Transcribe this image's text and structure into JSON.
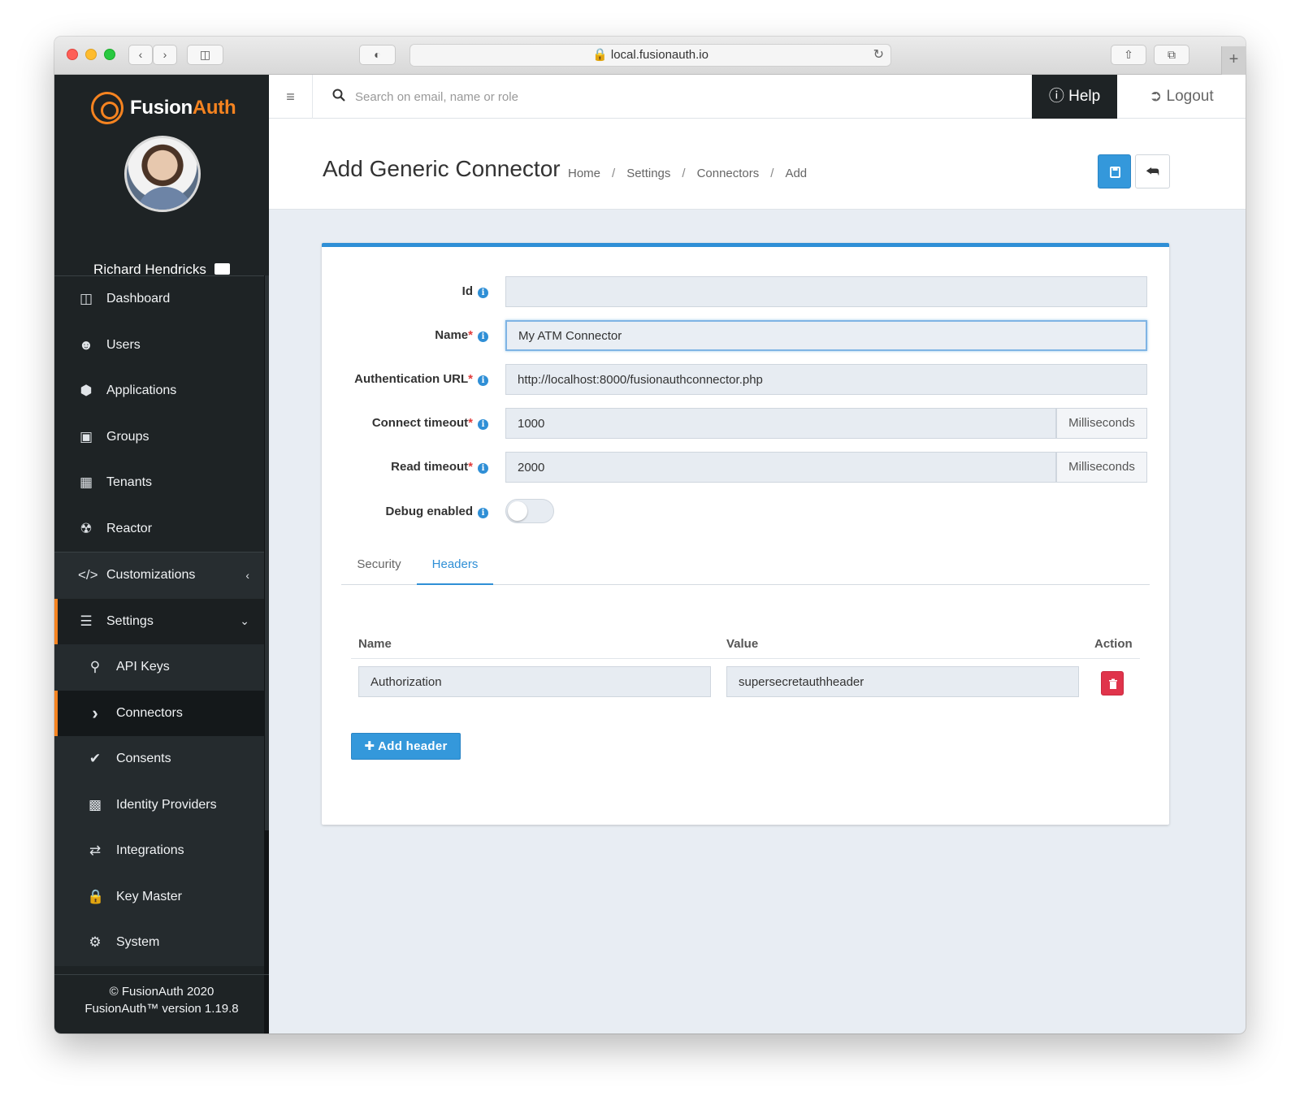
{
  "browser": {
    "url": "local.fusionauth.io"
  },
  "brand": {
    "name_part1": "Fusion",
    "name_part2": "Auth",
    "accent": "#f58320"
  },
  "user": {
    "name": "Richard Hendricks"
  },
  "topbar": {
    "search_placeholder": "Search on email, name or role",
    "help_label": "Help",
    "logout_label": "Logout"
  },
  "sidebar": {
    "items": [
      {
        "label": "Dashboard",
        "icon": "dashboard-icon"
      },
      {
        "label": "Users",
        "icon": "users-icon"
      },
      {
        "label": "Applications",
        "icon": "cube-icon"
      },
      {
        "label": "Groups",
        "icon": "groups-icon"
      },
      {
        "label": "Tenants",
        "icon": "building-icon"
      },
      {
        "label": "Reactor",
        "icon": "reactor-icon"
      }
    ],
    "customizations_label": "Customizations",
    "settings_label": "Settings",
    "settings_children": [
      {
        "label": "API Keys",
        "icon": "key-icon"
      },
      {
        "label": "Connectors",
        "icon": "chevron-right-icon"
      },
      {
        "label": "Consents",
        "icon": "check-icon"
      },
      {
        "label": "Identity Providers",
        "icon": "id-badge-icon"
      },
      {
        "label": "Integrations",
        "icon": "exchange-icon"
      },
      {
        "label": "Key Master",
        "icon": "lock-icon"
      },
      {
        "label": "System",
        "icon": "gear-icon"
      }
    ],
    "footer_line1": "© FusionAuth 2020",
    "footer_line2": "FusionAuth™ version 1.19.8"
  },
  "page": {
    "title": "Add Generic Connector",
    "breadcrumb": [
      "Home",
      "Settings",
      "Connectors",
      "Add"
    ]
  },
  "form": {
    "id_label": "Id",
    "id_value": "",
    "name_label": "Name",
    "name_value": "My ATM Connector",
    "auth_url_label": "Authentication URL",
    "auth_url_value": "http://localhost:8000/fusionauthconnector.php",
    "connect_timeout_label": "Connect timeout",
    "connect_timeout_value": "1000",
    "read_timeout_label": "Read timeout",
    "read_timeout_value": "2000",
    "timeout_unit": "Milliseconds",
    "debug_label": "Debug enabled",
    "debug_enabled": false,
    "required_mark": "*"
  },
  "tabs": [
    {
      "label": "Security",
      "active": false
    },
    {
      "label": "Headers",
      "active": true
    }
  ],
  "headers_table": {
    "columns": [
      "Name",
      "Value",
      "Action"
    ],
    "rows": [
      {
        "name": "Authorization",
        "value": "supersecretauthheader"
      }
    ],
    "add_label": "Add header"
  }
}
